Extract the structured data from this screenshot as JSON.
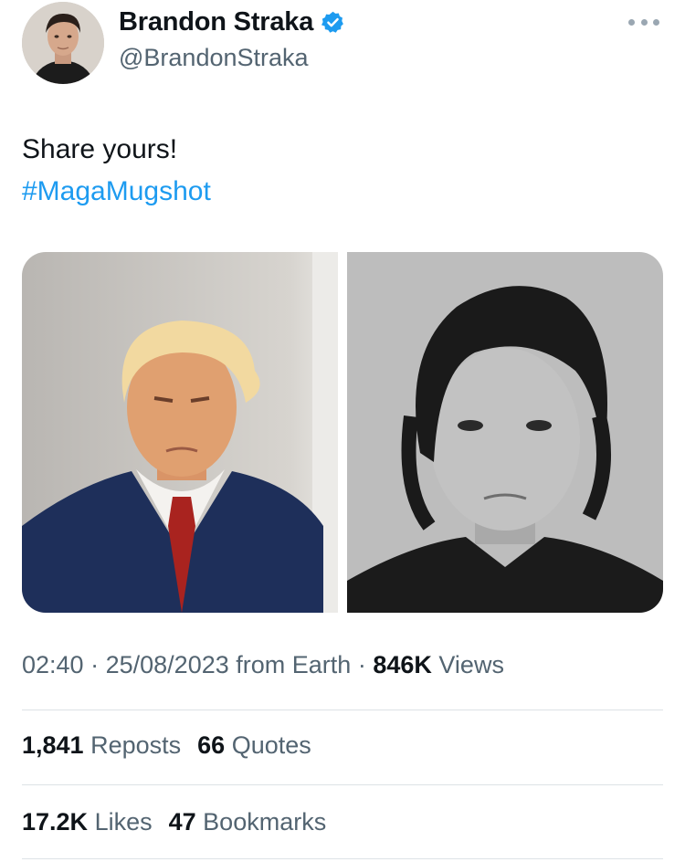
{
  "author": {
    "name": "Brandon Straka",
    "handle": "@BrandonStraka",
    "verified": true
  },
  "post": {
    "text": "Share yours!",
    "hashtag": "#MagaMugshot"
  },
  "media": [
    {
      "icon": "mugshot-photo-left"
    },
    {
      "icon": "mugshot-photo-right"
    }
  ],
  "meta": {
    "time": "02:40",
    "date": "25/08/2023",
    "source": "from Earth",
    "views_count": "846K",
    "views_label": "Views",
    "separator": "·"
  },
  "stats_row1": {
    "reposts_count": "1,841",
    "reposts_label": "Reposts",
    "quotes_count": "66",
    "quotes_label": "Quotes"
  },
  "stats_row2": {
    "likes_count": "17.2K",
    "likes_label": "Likes",
    "bookmarks_count": "47",
    "bookmarks_label": "Bookmarks"
  },
  "colors": {
    "accent": "#1d9bf0",
    "text": "#0f1419",
    "secondary": "#536471"
  }
}
